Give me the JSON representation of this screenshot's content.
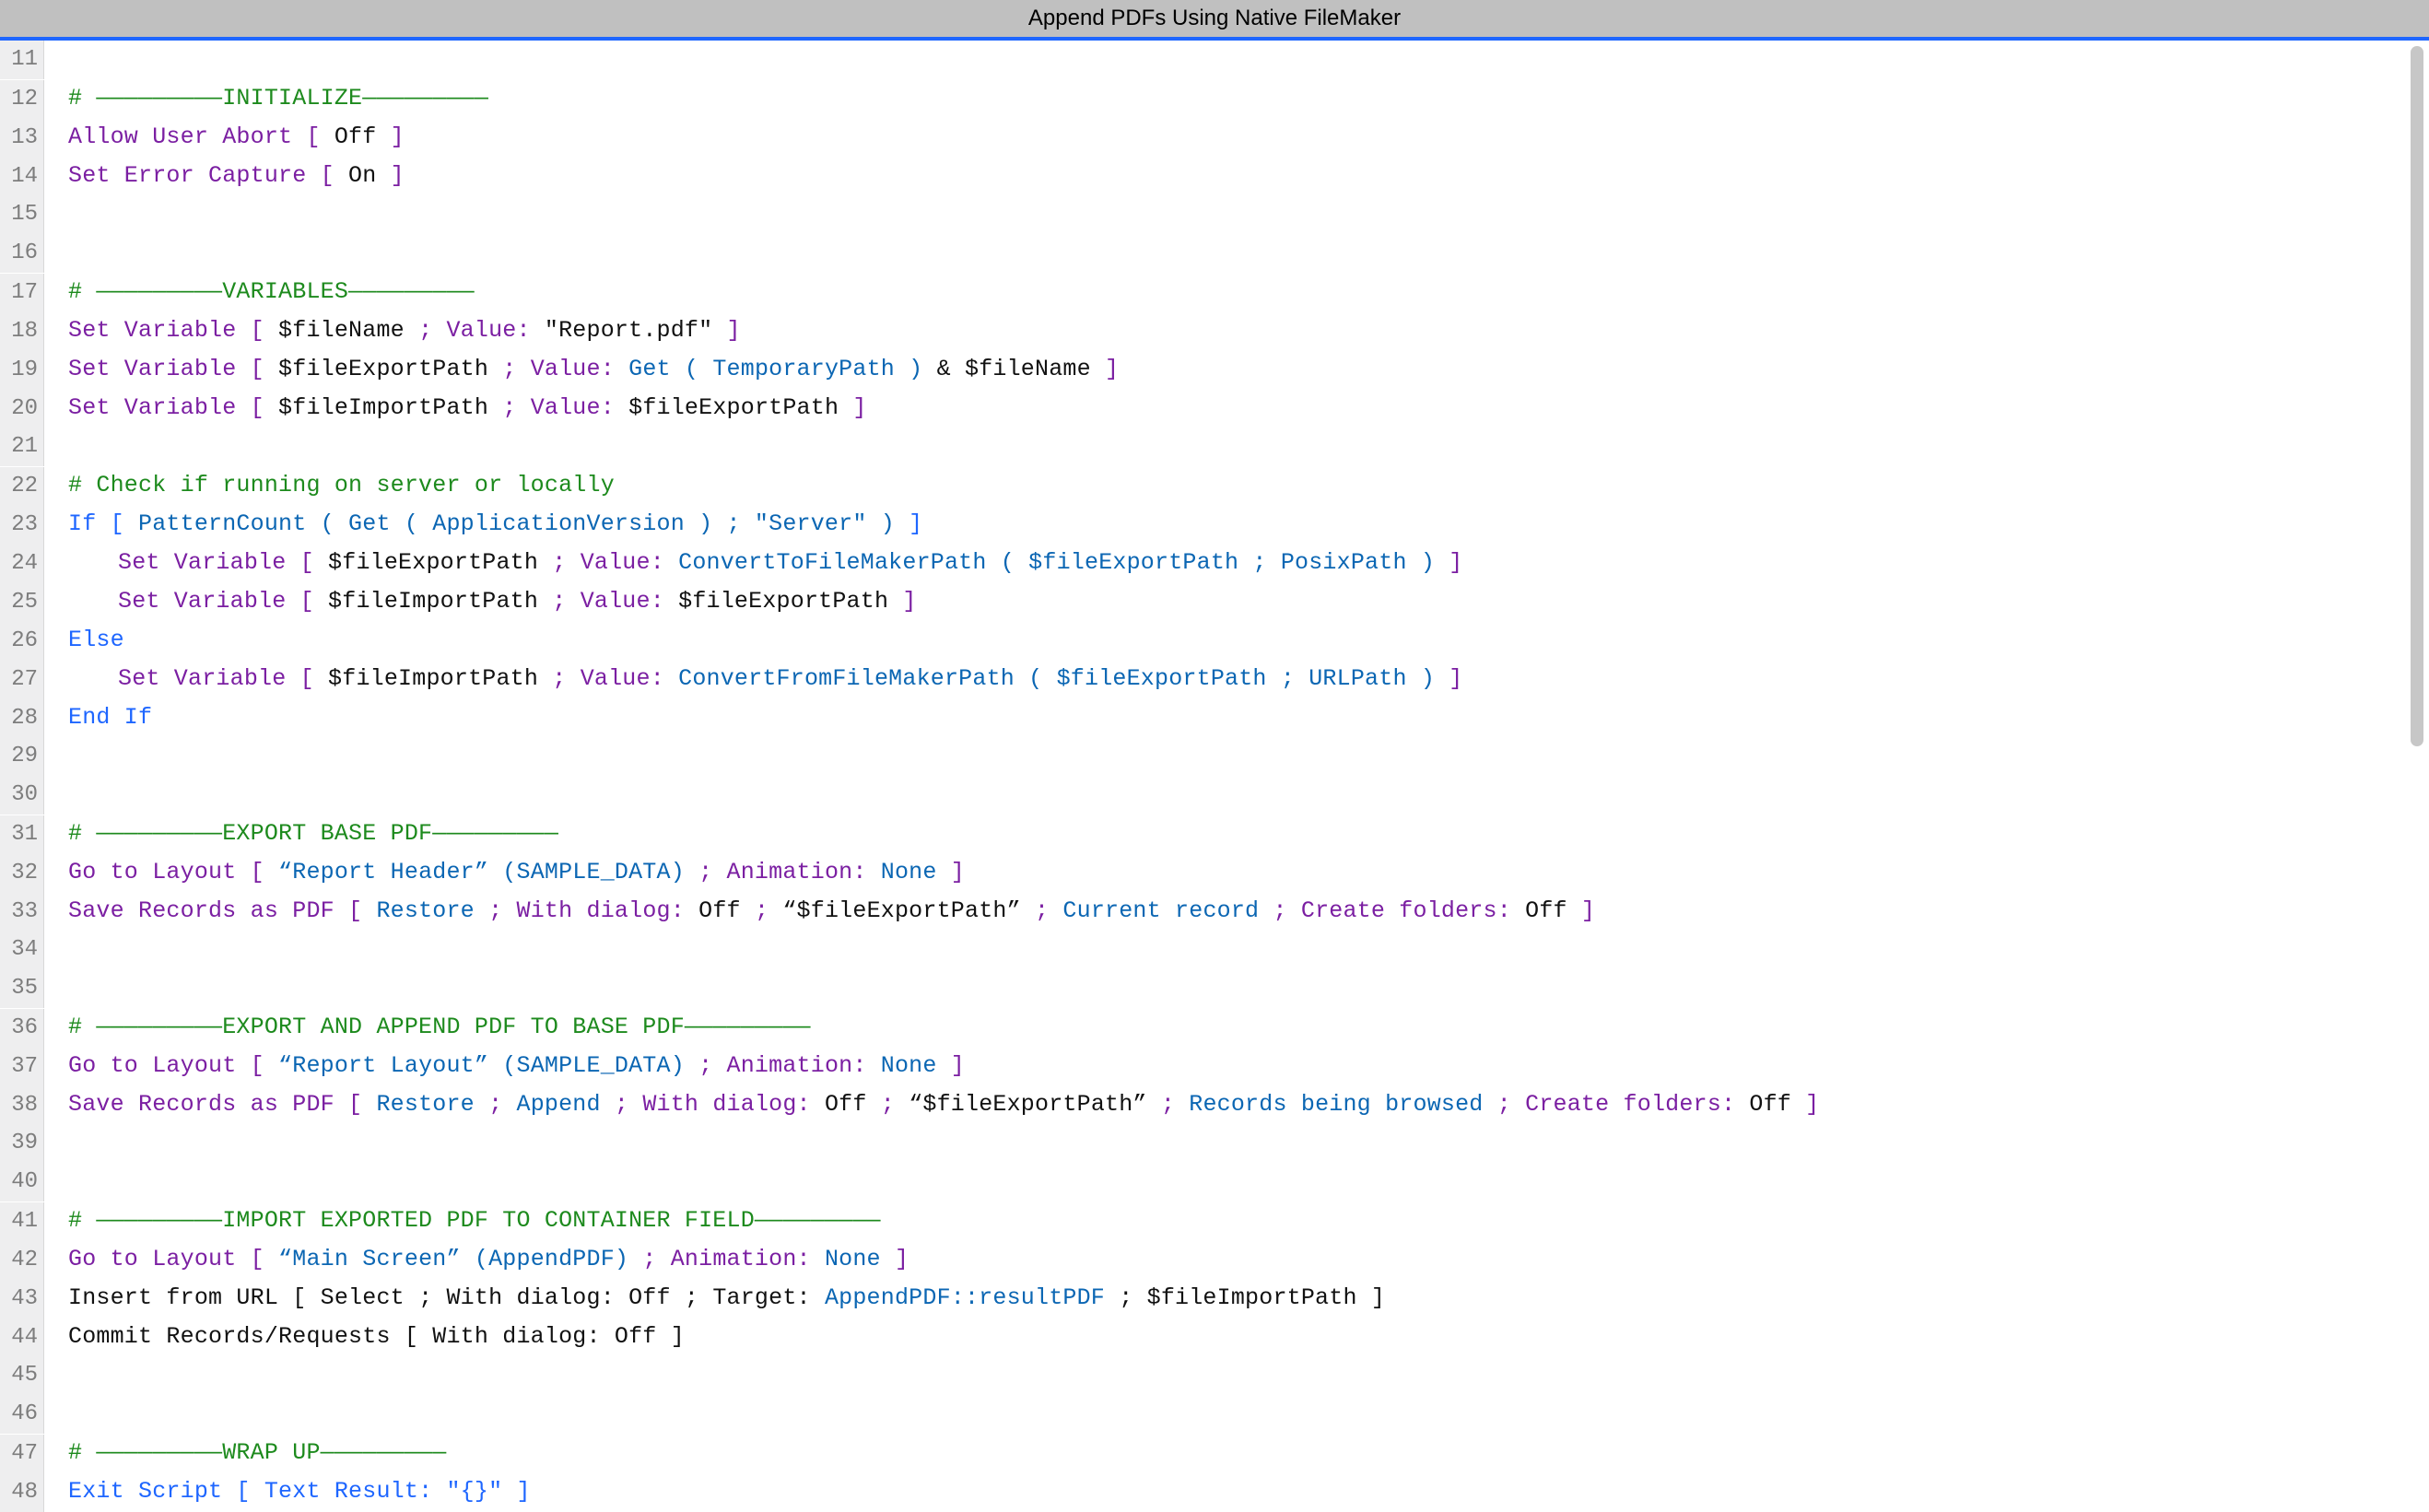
{
  "title": "Append PDFs Using Native FileMaker",
  "lines": [
    {
      "n": 11,
      "segs": []
    },
    {
      "n": 12,
      "segs": [
        {
          "cls": "c-comment",
          "t": "# —————————INITIALIZE—————————"
        }
      ]
    },
    {
      "n": 13,
      "segs": [
        {
          "cls": "c-key",
          "t": "Allow User Abort"
        },
        {
          "cls": "c-key",
          "t": " ["
        },
        {
          "cls": "c-plain",
          "t": " Off "
        },
        {
          "cls": "c-key",
          "t": "]"
        }
      ]
    },
    {
      "n": 14,
      "segs": [
        {
          "cls": "c-key",
          "t": "Set Error Capture"
        },
        {
          "cls": "c-key",
          "t": " ["
        },
        {
          "cls": "c-plain",
          "t": " On "
        },
        {
          "cls": "c-key",
          "t": "]"
        }
      ]
    },
    {
      "n": 15,
      "segs": []
    },
    {
      "n": 16,
      "segs": []
    },
    {
      "n": 17,
      "segs": [
        {
          "cls": "c-comment",
          "t": "# —————————VARIABLES—————————"
        }
      ]
    },
    {
      "n": 18,
      "segs": [
        {
          "cls": "c-key",
          "t": "Set Variable"
        },
        {
          "cls": "c-key",
          "t": " [ "
        },
        {
          "cls": "c-plain",
          "t": "$fileName"
        },
        {
          "cls": "c-key",
          "t": " ; Value: "
        },
        {
          "cls": "c-plain",
          "t": "\"Report.pdf\""
        },
        {
          "cls": "c-key",
          "t": " ]"
        }
      ]
    },
    {
      "n": 19,
      "segs": [
        {
          "cls": "c-key",
          "t": "Set Variable"
        },
        {
          "cls": "c-key",
          "t": " [ "
        },
        {
          "cls": "c-plain",
          "t": "$fileExportPath"
        },
        {
          "cls": "c-key",
          "t": " ; Value: "
        },
        {
          "cls": "c-fn",
          "t": "Get ( TemporaryPath )"
        },
        {
          "cls": "c-plain",
          "t": " & $fileName"
        },
        {
          "cls": "c-key",
          "t": " ]"
        }
      ]
    },
    {
      "n": 20,
      "segs": [
        {
          "cls": "c-key",
          "t": "Set Variable"
        },
        {
          "cls": "c-key",
          "t": " [ "
        },
        {
          "cls": "c-plain",
          "t": "$fileImportPath"
        },
        {
          "cls": "c-key",
          "t": " ; Value: "
        },
        {
          "cls": "c-plain",
          "t": "$fileExportPath"
        },
        {
          "cls": "c-key",
          "t": " ]"
        }
      ]
    },
    {
      "n": 21,
      "segs": []
    },
    {
      "n": 22,
      "segs": [
        {
          "cls": "c-comment",
          "t": "# Check if running on server or locally"
        }
      ]
    },
    {
      "n": 23,
      "segs": [
        {
          "cls": "c-flow",
          "t": "If"
        },
        {
          "cls": "c-flow",
          "t": " [ "
        },
        {
          "cls": "c-fn",
          "t": "PatternCount ( Get ( ApplicationVersion ) ; \"Server\" )"
        },
        {
          "cls": "c-flow",
          "t": " ]"
        }
      ]
    },
    {
      "n": 24,
      "indent": 1,
      "segs": [
        {
          "cls": "c-key",
          "t": "Set Variable"
        },
        {
          "cls": "c-key",
          "t": " [ "
        },
        {
          "cls": "c-plain",
          "t": "$fileExportPath"
        },
        {
          "cls": "c-key",
          "t": " ; Value: "
        },
        {
          "cls": "c-fn",
          "t": "ConvertToFileMakerPath ( $fileExportPath ; PosixPath )"
        },
        {
          "cls": "c-key",
          "t": " ]"
        }
      ]
    },
    {
      "n": 25,
      "indent": 1,
      "segs": [
        {
          "cls": "c-key",
          "t": "Set Variable"
        },
        {
          "cls": "c-key",
          "t": " [ "
        },
        {
          "cls": "c-plain",
          "t": "$fileImportPath"
        },
        {
          "cls": "c-key",
          "t": " ; Value: "
        },
        {
          "cls": "c-plain",
          "t": "$fileExportPath"
        },
        {
          "cls": "c-key",
          "t": " ]"
        }
      ]
    },
    {
      "n": 26,
      "segs": [
        {
          "cls": "c-flow",
          "t": "Else"
        }
      ]
    },
    {
      "n": 27,
      "indent": 1,
      "segs": [
        {
          "cls": "c-key",
          "t": "Set Variable"
        },
        {
          "cls": "c-key",
          "t": " [ "
        },
        {
          "cls": "c-plain",
          "t": "$fileImportPath"
        },
        {
          "cls": "c-key",
          "t": " ; Value: "
        },
        {
          "cls": "c-fn",
          "t": "ConvertFromFileMakerPath ( $fileExportPath ; URLPath )"
        },
        {
          "cls": "c-key",
          "t": " ]"
        }
      ]
    },
    {
      "n": 28,
      "segs": [
        {
          "cls": "c-flow",
          "t": "End If"
        }
      ]
    },
    {
      "n": 29,
      "segs": []
    },
    {
      "n": 30,
      "segs": []
    },
    {
      "n": 31,
      "segs": [
        {
          "cls": "c-comment",
          "t": "# —————————EXPORT BASE PDF—————————"
        }
      ]
    },
    {
      "n": 32,
      "segs": [
        {
          "cls": "c-key",
          "t": "Go to Layout"
        },
        {
          "cls": "c-key",
          "t": " [ "
        },
        {
          "cls": "c-fn",
          "t": "“Report Header” (SAMPLE_DATA)"
        },
        {
          "cls": "c-key",
          "t": " ; Animation: "
        },
        {
          "cls": "c-fn",
          "t": "None"
        },
        {
          "cls": "c-key",
          "t": " ]"
        }
      ]
    },
    {
      "n": 33,
      "segs": [
        {
          "cls": "c-key",
          "t": "Save Records as PDF"
        },
        {
          "cls": "c-key",
          "t": " [ "
        },
        {
          "cls": "c-fn",
          "t": "Restore"
        },
        {
          "cls": "c-key",
          "t": " ; With dialog: "
        },
        {
          "cls": "c-plain",
          "t": "Off"
        },
        {
          "cls": "c-key",
          "t": " ; "
        },
        {
          "cls": "c-plain",
          "t": "“$fileExportPath”"
        },
        {
          "cls": "c-key",
          "t": " ; "
        },
        {
          "cls": "c-fn",
          "t": "Current record"
        },
        {
          "cls": "c-key",
          "t": " ; Create folders: "
        },
        {
          "cls": "c-plain",
          "t": "Off"
        },
        {
          "cls": "c-key",
          "t": " ]"
        }
      ]
    },
    {
      "n": 34,
      "segs": []
    },
    {
      "n": 35,
      "segs": []
    },
    {
      "n": 36,
      "segs": [
        {
          "cls": "c-comment",
          "t": "# —————————EXPORT AND APPEND PDF TO BASE PDF—————————"
        }
      ]
    },
    {
      "n": 37,
      "segs": [
        {
          "cls": "c-key",
          "t": "Go to Layout"
        },
        {
          "cls": "c-key",
          "t": " [ "
        },
        {
          "cls": "c-fn",
          "t": "“Report Layout” (SAMPLE_DATA)"
        },
        {
          "cls": "c-key",
          "t": " ; Animation: "
        },
        {
          "cls": "c-fn",
          "t": "None"
        },
        {
          "cls": "c-key",
          "t": " ]"
        }
      ]
    },
    {
      "n": 38,
      "segs": [
        {
          "cls": "c-key",
          "t": "Save Records as PDF"
        },
        {
          "cls": "c-key",
          "t": " [ "
        },
        {
          "cls": "c-fn",
          "t": "Restore"
        },
        {
          "cls": "c-key",
          "t": " ; "
        },
        {
          "cls": "c-fn",
          "t": "Append"
        },
        {
          "cls": "c-key",
          "t": " ; With dialog: "
        },
        {
          "cls": "c-plain",
          "t": "Off"
        },
        {
          "cls": "c-key",
          "t": " ; "
        },
        {
          "cls": "c-plain",
          "t": "“$fileExportPath”"
        },
        {
          "cls": "c-key",
          "t": " ; "
        },
        {
          "cls": "c-fn",
          "t": "Records being browsed"
        },
        {
          "cls": "c-key",
          "t": " ; Create folders: "
        },
        {
          "cls": "c-plain",
          "t": "Off"
        },
        {
          "cls": "c-key",
          "t": " ]"
        }
      ]
    },
    {
      "n": 39,
      "segs": []
    },
    {
      "n": 40,
      "segs": []
    },
    {
      "n": 41,
      "segs": [
        {
          "cls": "c-comment",
          "t": "# —————————IMPORT EXPORTED PDF TO CONTAINER FIELD—————————"
        }
      ]
    },
    {
      "n": 42,
      "segs": [
        {
          "cls": "c-key",
          "t": "Go to Layout"
        },
        {
          "cls": "c-key",
          "t": " [ "
        },
        {
          "cls": "c-fn",
          "t": "“Main Screen” (AppendPDF)"
        },
        {
          "cls": "c-key",
          "t": " ; Animation: "
        },
        {
          "cls": "c-fn",
          "t": "None"
        },
        {
          "cls": "c-key",
          "t": " ]"
        }
      ]
    },
    {
      "n": 43,
      "segs": [
        {
          "cls": "c-plain",
          "t": "Insert from URL"
        },
        {
          "cls": "c-plain",
          "t": " [ Select ; With dialog: "
        },
        {
          "cls": "c-plain",
          "t": "Off"
        },
        {
          "cls": "c-plain",
          "t": " ; Target: "
        },
        {
          "cls": "c-fn",
          "t": "AppendPDF::resultPDF"
        },
        {
          "cls": "c-plain",
          "t": " ; $fileImportPath ]"
        }
      ]
    },
    {
      "n": 44,
      "segs": [
        {
          "cls": "c-plain",
          "t": "Commit Records/Requests"
        },
        {
          "cls": "c-plain",
          "t": " [ With dialog: "
        },
        {
          "cls": "c-plain",
          "t": "Off"
        },
        {
          "cls": "c-plain",
          "t": " ]"
        }
      ]
    },
    {
      "n": 45,
      "segs": []
    },
    {
      "n": 46,
      "segs": []
    },
    {
      "n": 47,
      "segs": [
        {
          "cls": "c-comment",
          "t": "# —————————WRAP UP—————————"
        }
      ]
    },
    {
      "n": 48,
      "segs": [
        {
          "cls": "c-flow",
          "t": "Exit Script"
        },
        {
          "cls": "c-flow",
          "t": " [ Text Result: "
        },
        {
          "cls": "c-flow",
          "t": "\"{}\""
        },
        {
          "cls": "c-flow",
          "t": " ]"
        }
      ]
    }
  ]
}
